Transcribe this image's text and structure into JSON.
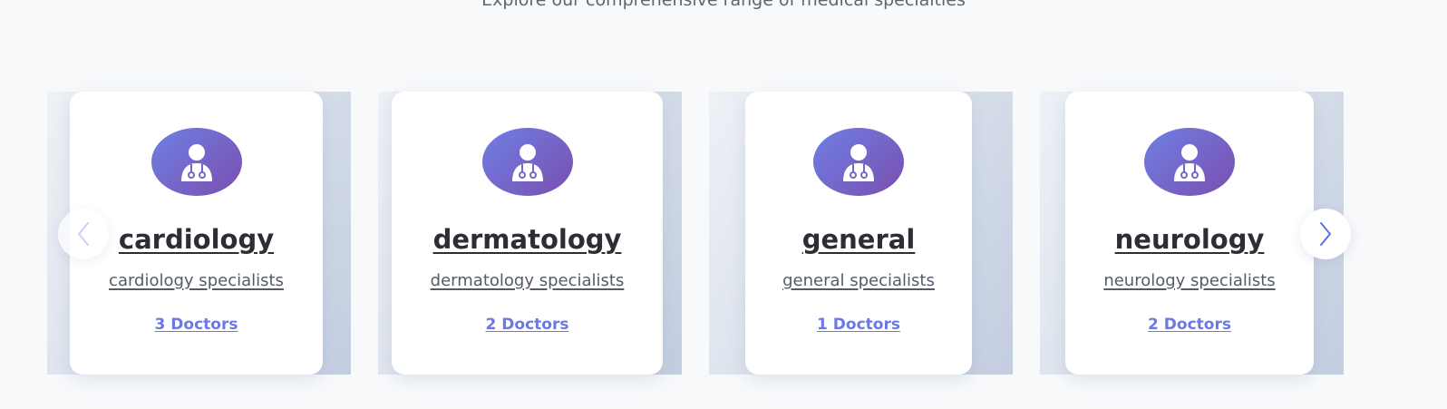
{
  "section": {
    "subtitle": "Explore our comprehensive range of medical specialties"
  },
  "carousel": {
    "prev_icon": "chevron-left-icon",
    "next_icon": "chevron-right-icon",
    "cards": [
      {
        "title": "cardiology",
        "description": "cardiology specialists",
        "doctors": "3 Doctors",
        "icon": "doctor-icon"
      },
      {
        "title": "dermatology",
        "description": "dermatology specialists",
        "doctors": "2 Doctors",
        "icon": "doctor-icon"
      },
      {
        "title": "general",
        "description": "general specialists",
        "doctors": "1 Doctors",
        "icon": "doctor-icon"
      },
      {
        "title": "neurology",
        "description": "neurology specialists",
        "doctors": "2 Doctors",
        "icon": "doctor-icon"
      }
    ]
  },
  "colors": {
    "background": "#f7f9fb",
    "accent": "#6b78e5",
    "avatar_gradient_start": "#6f7fe3",
    "avatar_gradient_end": "#7a4fb0"
  }
}
